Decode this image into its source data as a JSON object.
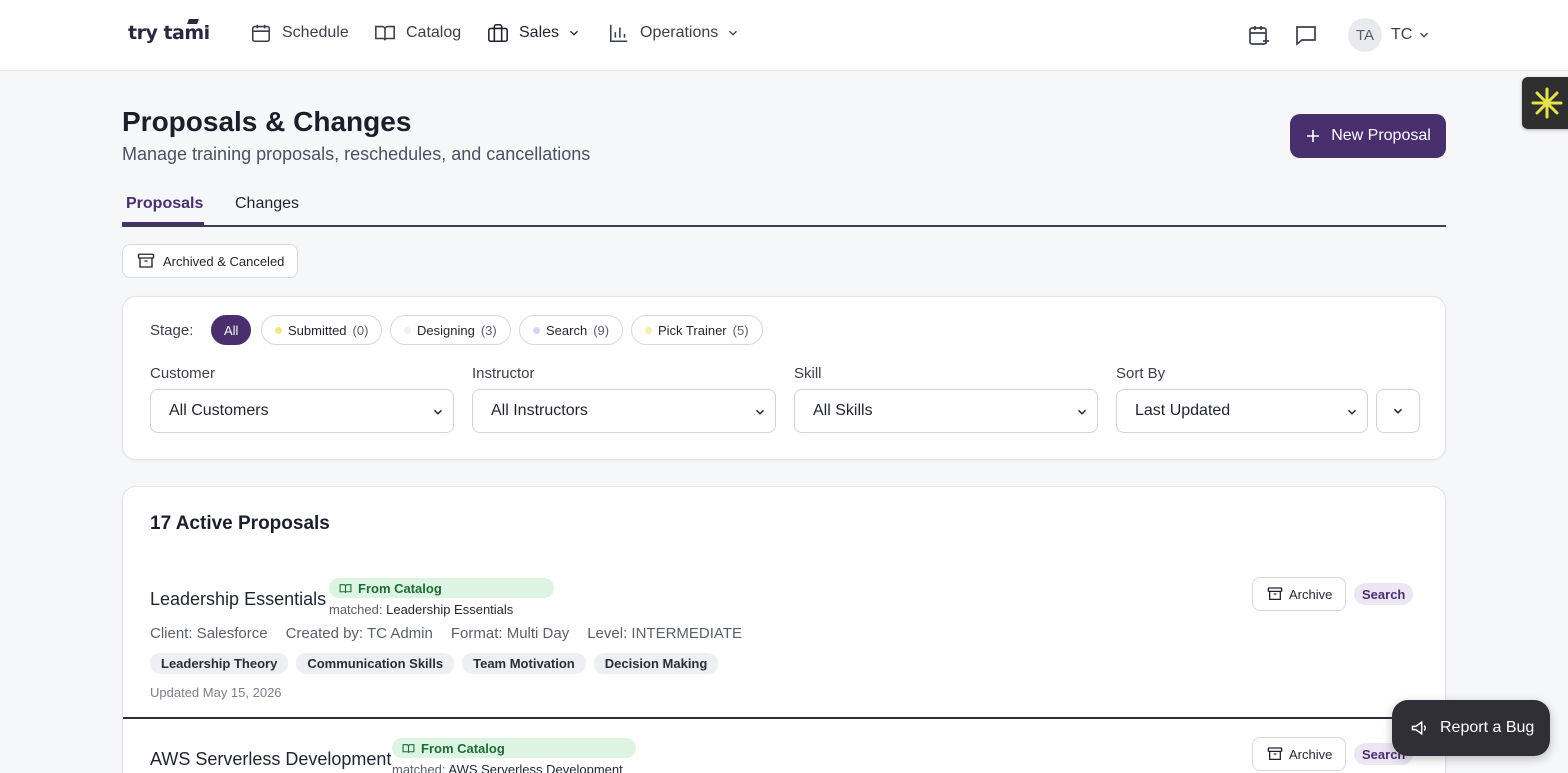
{
  "nav": {
    "logo": "try tami",
    "items": [
      {
        "label": "Schedule",
        "icon": "calendar-icon"
      },
      {
        "label": "Catalog",
        "icon": "book-icon"
      },
      {
        "label": "Sales",
        "icon": "briefcase-icon",
        "has_dropdown": true
      },
      {
        "label": "Operations",
        "icon": "bar-chart-icon",
        "has_dropdown": true
      }
    ],
    "avatar_initials": "TA",
    "user_label": "TC"
  },
  "header": {
    "title": "Proposals & Changes",
    "subtitle": "Manage training proposals, reschedules, and cancellations",
    "new_button": "New Proposal"
  },
  "tabs": [
    {
      "label": "Proposals",
      "active": true
    },
    {
      "label": "Changes",
      "active": false
    }
  ],
  "archived_button": "Archived & Canceled",
  "filters": {
    "stage_label": "Stage:",
    "stages": [
      {
        "label": "All",
        "count": null,
        "active": true
      },
      {
        "label": "Submitted",
        "count": "(0)",
        "dot_color": "#f5e58a"
      },
      {
        "label": "Designing",
        "count": "(3)",
        "dot_color": "#eef0f5"
      },
      {
        "label": "Search",
        "count": "(9)",
        "dot_color": "#dcd3f0"
      },
      {
        "label": "Pick Trainer",
        "count": "(5)",
        "dot_color": "#f7f0a8"
      }
    ],
    "customer": {
      "label": "Customer",
      "value": "All Customers"
    },
    "instructor": {
      "label": "Instructor",
      "value": "All Instructors"
    },
    "skill": {
      "label": "Skill",
      "value": "All Skills"
    },
    "sort": {
      "label": "Sort By",
      "value": "Last Updated"
    }
  },
  "list": {
    "title": "17 Active Proposals",
    "items": [
      {
        "name": "Leadership Essentials",
        "badge": "From Catalog",
        "matched_prefix": "matched:",
        "matched_value": "Leadership Essentials",
        "client": "Client: Salesforce",
        "created_by": "Created by: TC Admin",
        "format": "Format: Multi Day",
        "level": "Level: INTERMEDIATE",
        "skills": [
          "Leadership Theory",
          "Communication Skills",
          "Team Motivation",
          "Decision Making"
        ],
        "updated": "Updated May 15, 2026",
        "archive_label": "Archive",
        "stage": "Search"
      },
      {
        "name": "AWS Serverless Development",
        "badge": "From Catalog",
        "matched_prefix": "matched:",
        "matched_value": "AWS Serverless Development",
        "archive_label": "Archive",
        "stage": "Search"
      }
    ]
  },
  "report_bug": "Report a Bug",
  "colors": {
    "accent": "#4a2f6e",
    "catalog_badge_bg": "#def4e2",
    "catalog_badge_text": "#1f6b38",
    "stage_badge_bg": "#ece6f4"
  }
}
